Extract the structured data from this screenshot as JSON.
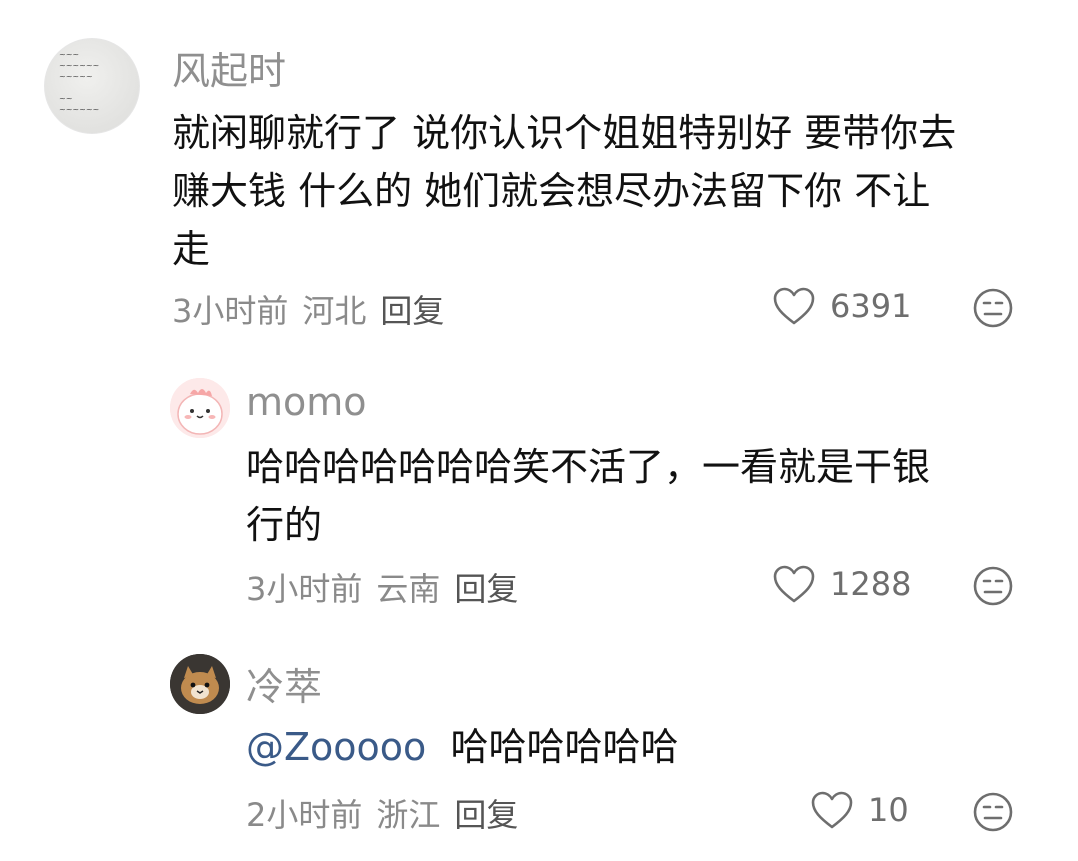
{
  "comments": [
    {
      "username": "风起时",
      "text_line1": "就闲聊就行了 说你认识个姐姐特别好 要带你去",
      "text_line2": "赚大钱 什么的 她们就会想尽办法留下你 不让",
      "text_line3": "走",
      "time": "3小时前",
      "location": "河北",
      "reply_label": "回复",
      "likes": "6391",
      "avatar_icon": "handwritten-note-avatar",
      "like_icon": "heart-outline-icon",
      "dislike_icon": "meh-face-icon"
    },
    {
      "username": "momo",
      "text_line1": "哈哈哈哈哈哈哈笑不活了，一看就是干银",
      "text_line2": "行的",
      "time": "3小时前",
      "location": "云南",
      "reply_label": "回复",
      "likes": "1288",
      "avatar_icon": "pink-dino-avatar",
      "like_icon": "heart-outline-icon",
      "dislike_icon": "meh-face-icon"
    },
    {
      "username": "冷萃",
      "mention": "@Zooooo",
      "text": "哈哈哈哈哈哈",
      "time": "2小时前",
      "location": "浙江",
      "reply_label": "回复",
      "likes": "10",
      "avatar_icon": "cat-photo-avatar",
      "like_icon": "heart-outline-icon",
      "dislike_icon": "meh-face-icon"
    }
  ],
  "colors": {
    "username": "#8f8f8f",
    "content": "#111111",
    "meta": "#8a8a8a",
    "mention": "#3a5a88",
    "icon": "#6e6e6e"
  }
}
